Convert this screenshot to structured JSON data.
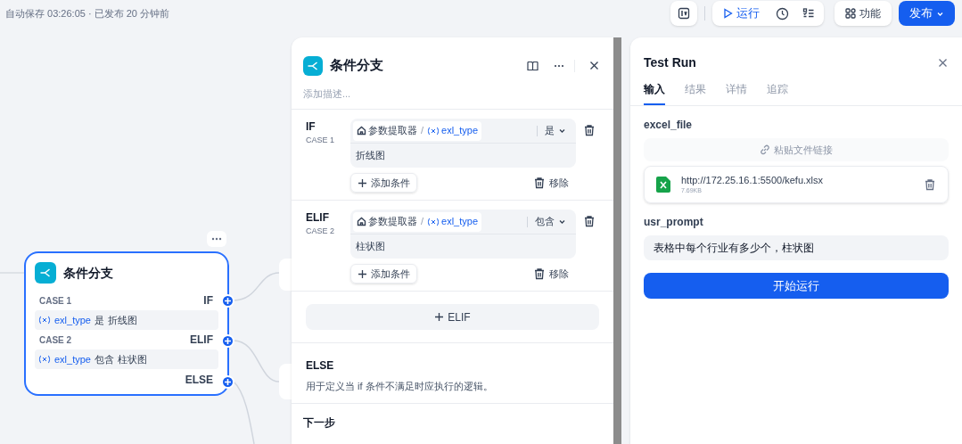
{
  "topbar": {
    "status": "自动保存 03:26:05 · 已发布 20 分钟前",
    "run": "运行",
    "features": "功能",
    "publish": "发布"
  },
  "node": {
    "title": "条件分支",
    "cases": [
      {
        "case": "CASE 1",
        "branch": "IF",
        "variable": "exl_type",
        "operator": "是",
        "value": "折线图"
      },
      {
        "case": "CASE 2",
        "branch": "ELIF",
        "variable": "exl_type",
        "operator": "包含",
        "value": "柱状图"
      }
    ],
    "else_branch": "ELSE"
  },
  "panel": {
    "title": "条件分支",
    "description_placeholder": "添加描述...",
    "cases": [
      {
        "branch": "IF",
        "case": "CASE 1",
        "source": "参数提取器",
        "separator": "/",
        "variable": "exl_type",
        "operator": "是",
        "value": "折线图",
        "add_condition": "添加条件",
        "remove": "移除"
      },
      {
        "branch": "ELIF",
        "case": "CASE 2",
        "source": "参数提取器",
        "separator": "/",
        "variable": "exl_type",
        "operator": "包含",
        "value": "柱状图",
        "add_condition": "添加条件",
        "remove": "移除"
      }
    ],
    "add_elif": "ELIF",
    "else": {
      "title": "ELSE",
      "description": "用于定义当 if 条件不满足时应执行的逻辑。"
    },
    "next_step": "下一步"
  },
  "test_run": {
    "title": "Test Run",
    "tabs": [
      {
        "label": "输入",
        "selected": true
      },
      {
        "label": "结果",
        "selected": false
      },
      {
        "label": "详情",
        "selected": false
      },
      {
        "label": "追踪",
        "selected": false
      }
    ],
    "fields": [
      {
        "kind": "file",
        "label": "excel_file",
        "paste_button": "粘贴文件链接",
        "file": {
          "name": "http://172.25.16.1:5500/kefu.xlsx",
          "size": "7.69KB"
        }
      },
      {
        "kind": "text",
        "label": "usr_prompt",
        "value": "表格中每个行业有多少个，柱状图"
      }
    ],
    "run_button": "开始运行"
  }
}
